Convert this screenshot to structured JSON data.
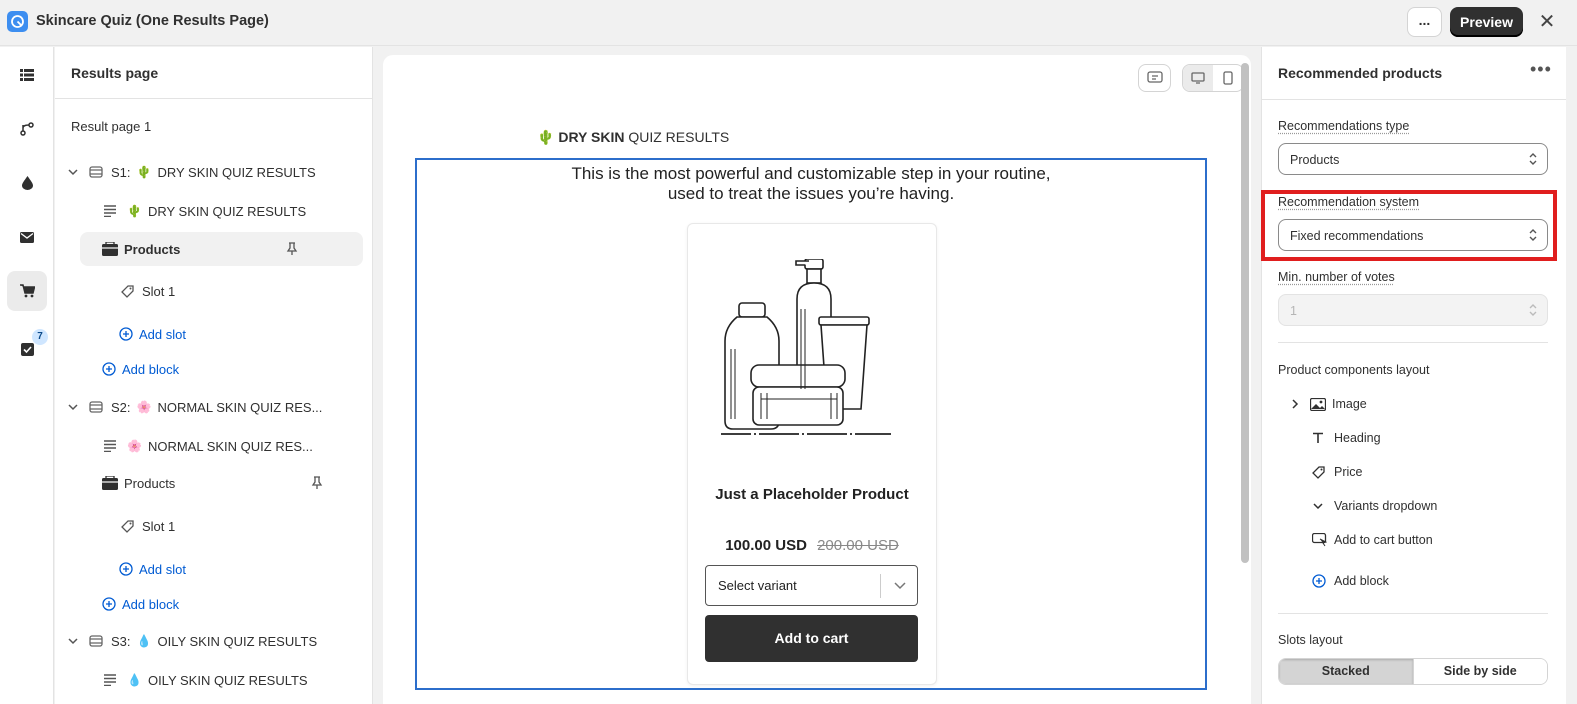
{
  "app": {
    "title": "Skincare Quiz (One Results Page)",
    "more_label": "...",
    "preview_label": "Preview",
    "close_label": "✕"
  },
  "iconbar": {
    "badge_count": "7"
  },
  "left_panel": {
    "title": "Results page",
    "page_label": "Result page 1",
    "sections": [
      {
        "label": "S1:",
        "emoji": "🌵",
        "name": "DRY SKIN QUIZ RESULTS",
        "text_block": "DRY SKIN QUIZ RESULTS",
        "products": "Products",
        "slot": "Slot 1",
        "add_slot": "Add slot",
        "add_block": "Add block"
      },
      {
        "label": "S2:",
        "emoji": "🌸",
        "name": "NORMAL SKIN QUIZ RES...",
        "text_block": "NORMAL SKIN QUIZ RES...",
        "products": "Products",
        "slot": "Slot 1",
        "add_slot": "Add slot",
        "add_block": "Add block"
      },
      {
        "label": "S3:",
        "emoji": "💧",
        "name": "OILY SKIN QUIZ RESULTS",
        "text_block": "OILY SKIN QUIZ RESULTS"
      }
    ]
  },
  "canvas": {
    "heading_emoji": "🌵",
    "heading_bold": "DRY SKIN",
    "heading_rest": "QUIZ RESULTS",
    "description_line1": "This is the most powerful and customizable step in your routine,",
    "description_line2": "used to treat the issues you’re having.",
    "product": {
      "title": "Just a Placeholder Product",
      "price": "100.00 USD",
      "compare_price": "200.00 USD",
      "variant_placeholder": "Select variant",
      "cart_label": "Add to cart"
    }
  },
  "right_panel": {
    "title": "Recommended products",
    "dots": "•••",
    "rec_type_label": "Recommendations type",
    "rec_type_value": "Products",
    "rec_system_label": "Recommendation system",
    "rec_system_value": "Fixed recommendations",
    "min_votes_label": "Min. number of votes",
    "min_votes_value": "1",
    "layout_label": "Product components layout",
    "components": [
      "Image",
      "Heading",
      "Price",
      "Variants dropdown",
      "Add to cart button"
    ],
    "add_block": "Add block",
    "slots_label": "Slots layout",
    "slots_options": [
      "Stacked",
      "Side by side"
    ]
  },
  "colors": {
    "accent": "#005bd3",
    "highlight": "#e01e1e",
    "selection": "#2c6ecb"
  }
}
